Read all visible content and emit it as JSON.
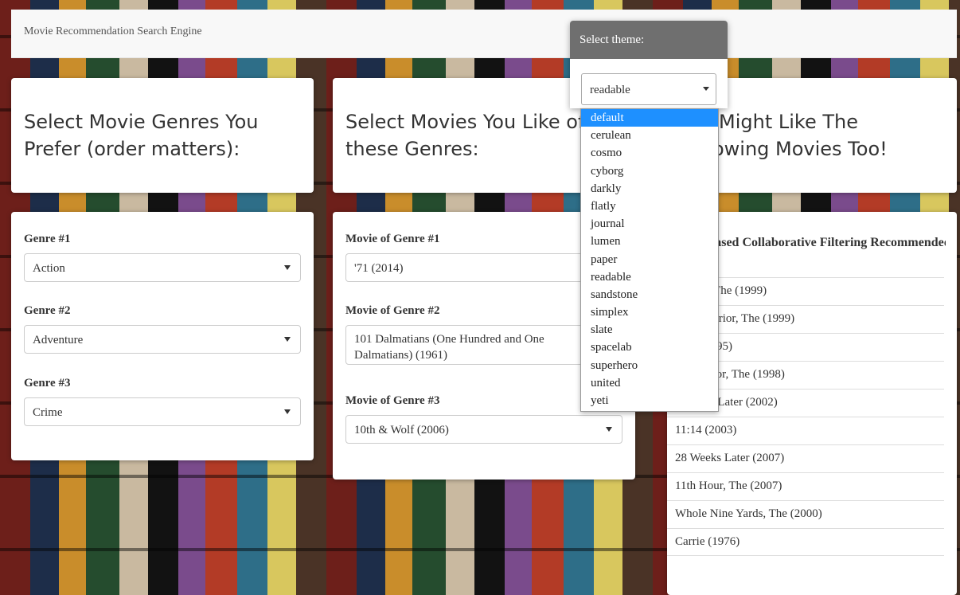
{
  "navbar": {
    "brand": "Movie Recommendation Search Engine"
  },
  "theme": {
    "label": "Select theme:",
    "selected": "readable",
    "options": [
      "default",
      "cerulean",
      "cosmo",
      "cyborg",
      "darkly",
      "flatly",
      "journal",
      "lumen",
      "paper",
      "readable",
      "sandstone",
      "simplex",
      "slate",
      "spacelab",
      "superhero",
      "united",
      "yeti"
    ],
    "highlighted": "default"
  },
  "genres": {
    "title": "Select Movie Genres You Prefer (order matters):",
    "fields": [
      {
        "label": "Genre #1",
        "value": "Action"
      },
      {
        "label": "Genre #2",
        "value": "Adventure"
      },
      {
        "label": "Genre #3",
        "value": "Crime"
      }
    ]
  },
  "movies": {
    "title": "Select Movies You Like of these Genres:",
    "fields": [
      {
        "label": "Movie of Genre #1",
        "value": "'71 (2014)"
      },
      {
        "label": "Movie of Genre #2",
        "value": "101 Dalmatians (One Hundred and One Dalmatians) (1961)"
      },
      {
        "label": "Movie of Genre #3",
        "value": "10th & Wolf (2006)"
      }
    ]
  },
  "recommend": {
    "title": "You Might Like The Following Movies Too!",
    "heading": "Item-based Collaborative Filtering Recommended",
    "items": [
      "Matrix, The (1999)",
      "13th Warrior, The (1999)",
      "Heat (1995)",
      "Negotiator, The (1998)",
      "28 Days Later (2002)",
      "11:14 (2003)",
      "28 Weeks Later (2007)",
      "11th Hour, The (2007)",
      "Whole Nine Yards, The (2000)",
      "Carrie (1976)"
    ]
  }
}
